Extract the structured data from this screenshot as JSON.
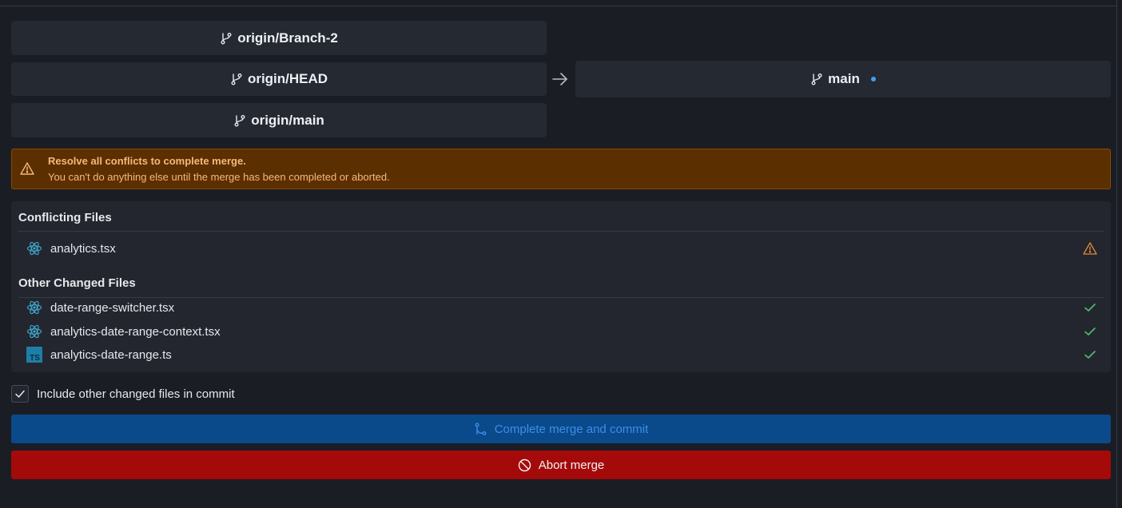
{
  "branches": {
    "sources": [
      {
        "label": "origin/Branch-2",
        "icon": "git-branch-icon"
      },
      {
        "label": "origin/HEAD",
        "icon": "git-branch-icon"
      },
      {
        "label": "origin/main",
        "icon": "git-branch-icon"
      }
    ],
    "target": {
      "label": "main",
      "icon": "git-branch-icon",
      "indicator_color": "#4a9bf0"
    },
    "arrow_icon": "arrow-right-icon"
  },
  "alert": {
    "icon": "warning-icon",
    "title": "Resolve all conflicts to complete merge.",
    "message": "You can't do anything else until the merge has been completed or aborted.",
    "background": "#5c2f00",
    "text_color": "#f5b97a"
  },
  "conflicting": {
    "title": "Conflicting Files",
    "files": [
      {
        "name": "analytics.tsx",
        "icon": "react-icon",
        "status_icon": "warning-icon"
      }
    ]
  },
  "other_changed": {
    "title": "Other Changed Files",
    "files": [
      {
        "name": "date-range-switcher.tsx",
        "icon": "react-icon",
        "status_icon": "check-icon"
      },
      {
        "name": "analytics-date-range-context.tsx",
        "icon": "react-icon",
        "status_icon": "check-icon"
      },
      {
        "name": "analytics-date-range.ts",
        "icon": "typescript-icon",
        "status_icon": "check-icon"
      }
    ]
  },
  "include_other": {
    "label": "Include other changed files in commit",
    "checked": true
  },
  "actions": {
    "complete_label": "Complete merge and commit",
    "complete_icon": "git-merge-icon",
    "complete_color": "#0a4a8a",
    "abort_label": "Abort merge",
    "abort_icon": "prohibited-icon",
    "abort_color": "#a50a0a"
  }
}
